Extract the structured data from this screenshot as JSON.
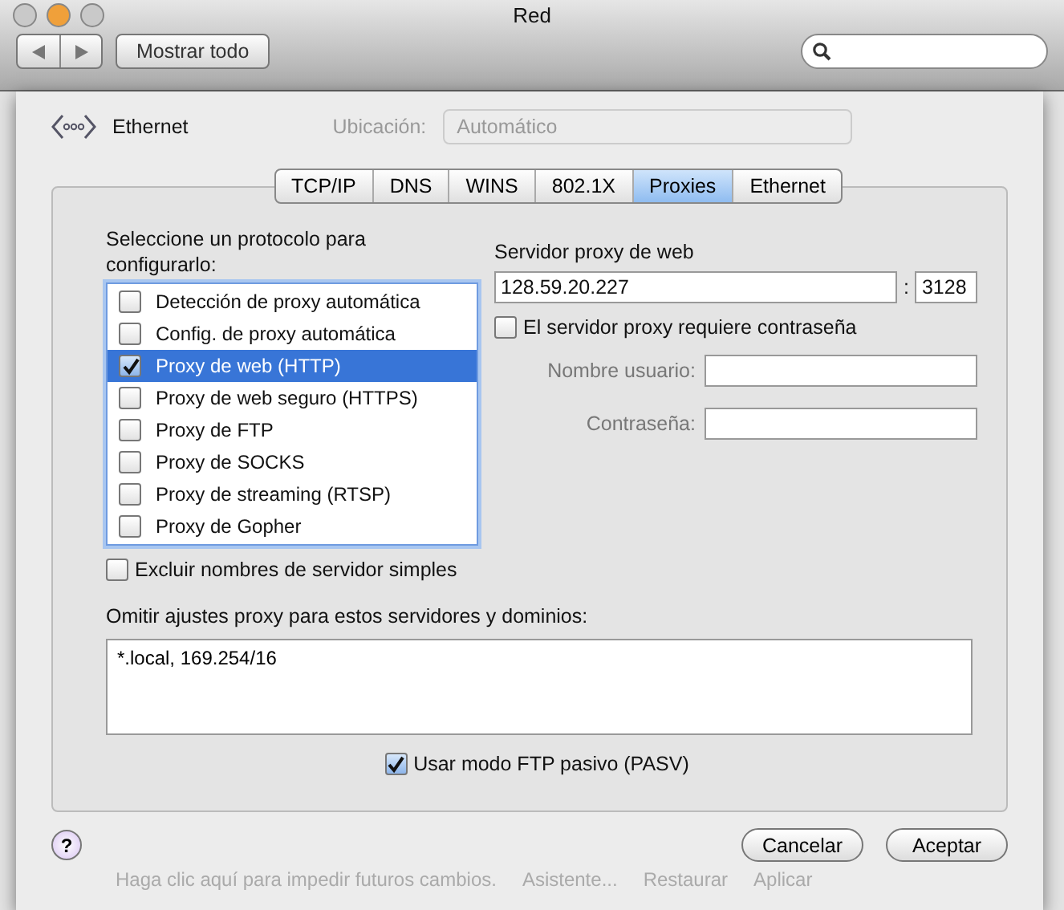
{
  "window": {
    "title": "Red"
  },
  "toolbar": {
    "show_all": "Mostrar todo"
  },
  "sheet": {
    "service": "Ethernet",
    "location_label": "Ubicación:",
    "location_value": "Automático",
    "tabs": [
      {
        "label": "TCP/IP",
        "selected": false
      },
      {
        "label": "DNS",
        "selected": false
      },
      {
        "label": "WINS",
        "selected": false
      },
      {
        "label": "802.1X",
        "selected": false
      },
      {
        "label": "Proxies",
        "selected": true
      },
      {
        "label": "Ethernet",
        "selected": false
      }
    ],
    "protocols_label": "Seleccione un protocolo para configurarlo:",
    "protocols": [
      {
        "label": "Detección de proxy automática",
        "checked": false,
        "selected": false
      },
      {
        "label": "Config. de proxy automática",
        "checked": false,
        "selected": false
      },
      {
        "label": "Proxy de web (HTTP)",
        "checked": true,
        "selected": true
      },
      {
        "label": "Proxy de web seguro (HTTPS)",
        "checked": false,
        "selected": false
      },
      {
        "label": "Proxy de FTP",
        "checked": false,
        "selected": false
      },
      {
        "label": "Proxy de SOCKS",
        "checked": false,
        "selected": false
      },
      {
        "label": "Proxy de streaming (RTSP)",
        "checked": false,
        "selected": false
      },
      {
        "label": "Proxy de Gopher",
        "checked": false,
        "selected": false
      }
    ],
    "exclude_simple": {
      "label": "Excluir nombres de servidor simples",
      "checked": false
    },
    "server_label": "Servidor proxy de web",
    "server_host": "128.59.20.227",
    "separator": ":",
    "server_port": "3128",
    "requires_password": {
      "label": "El servidor proxy requiere contraseña",
      "checked": false
    },
    "credentials_disabled": true,
    "username_label": "Nombre usuario:",
    "password_label": "Contraseña:",
    "bypass_label": "Omitir ajustes proxy para estos servidores y dominios:",
    "bypass_value": "*.local, 169.254/16",
    "passive_ftp": {
      "label": "Usar modo FTP pasivo (PASV)",
      "checked": true
    },
    "help": "?",
    "buttons": [
      "Cancelar",
      "Aceptar"
    ]
  },
  "background": {
    "lock_hint": "Haga clic aquí para impedir futuros cambios.",
    "buttons": [
      "Asistente...",
      "Restaurar",
      "Aplicar"
    ]
  }
}
